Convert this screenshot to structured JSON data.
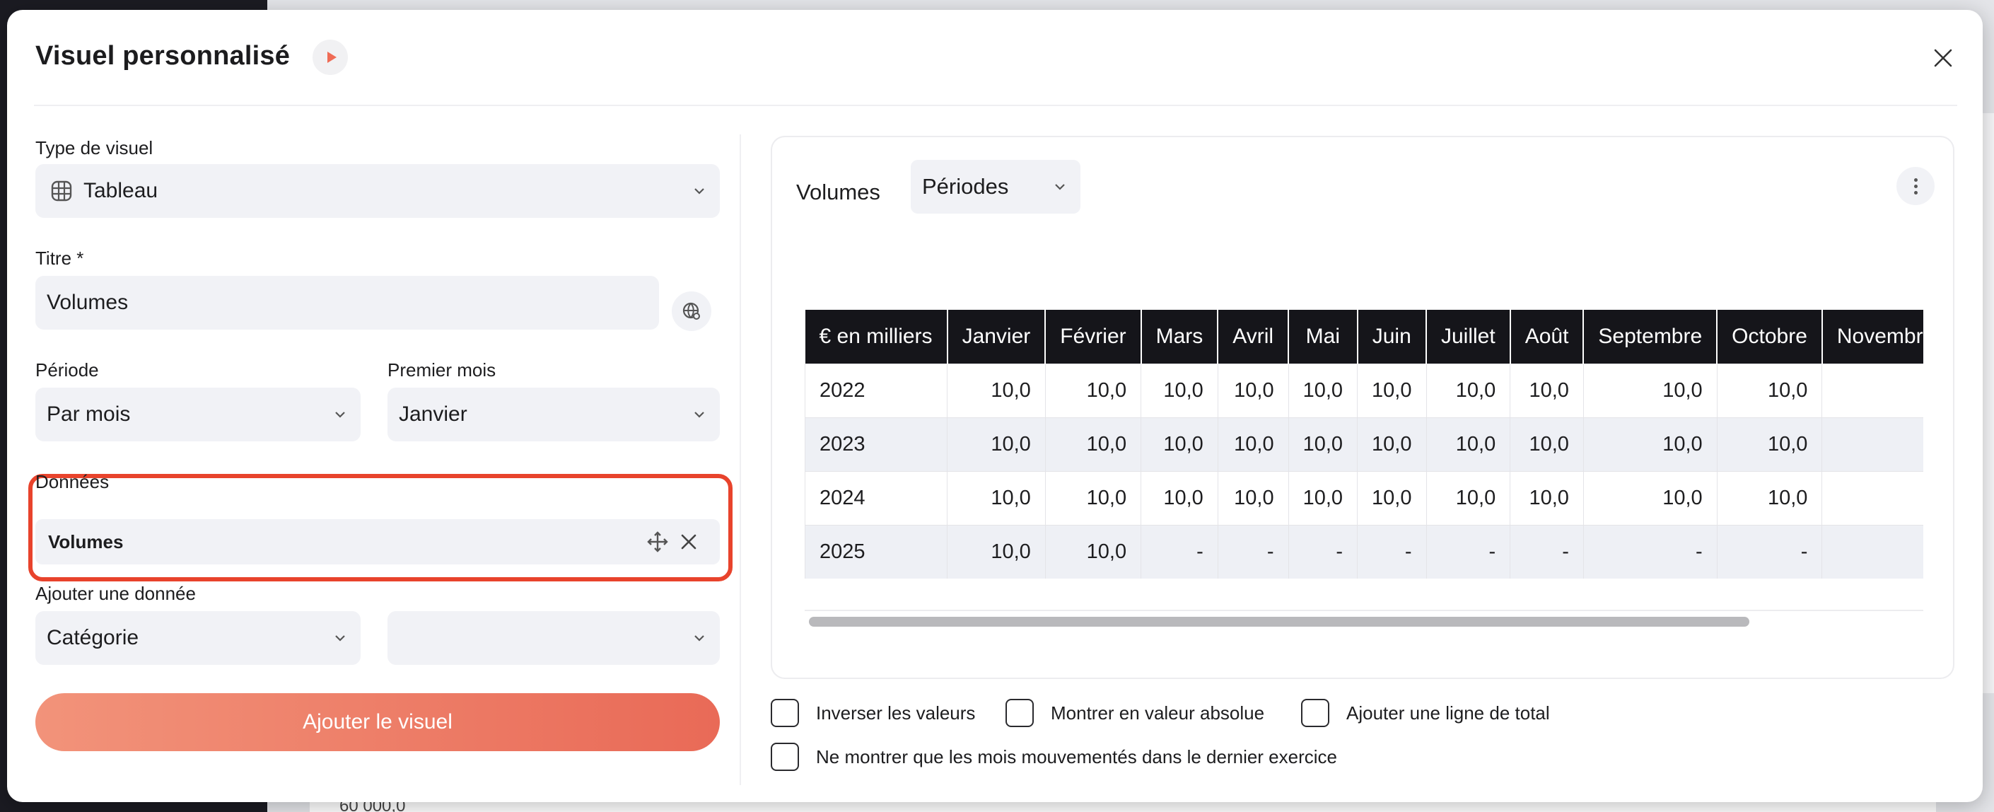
{
  "modal": {
    "title": "Visuel personnalisé"
  },
  "form": {
    "type_label": "Type de visuel",
    "type_value": "Tableau",
    "titre_label": "Titre *",
    "titre_value": "Volumes",
    "periode_label": "Période",
    "periode_value": "Par mois",
    "premier_mois_label": "Premier mois",
    "premier_mois_value": "Janvier",
    "donnees_label": "Données",
    "donnees_item": "Volumes",
    "ajouter_label": "Ajouter une donnée",
    "ajouter_category": "Catégorie",
    "ajouter_second": "",
    "submit": "Ajouter le visuel"
  },
  "preview": {
    "title": "Volumes",
    "select_value": "Périodes",
    "table": {
      "headers": [
        "€ en milliers",
        "Janvier",
        "Février",
        "Mars",
        "Avril",
        "Mai",
        "Juin",
        "Juillet",
        "Août",
        "Septembre",
        "Octobre",
        "Novembre"
      ],
      "rows": [
        [
          "2022",
          "10,0",
          "10,0",
          "10,0",
          "10,0",
          "10,0",
          "10,0",
          "10,0",
          "10,0",
          "10,0",
          "10,0",
          ""
        ],
        [
          "2023",
          "10,0",
          "10,0",
          "10,0",
          "10,0",
          "10,0",
          "10,0",
          "10,0",
          "10,0",
          "10,0",
          "10,0",
          ""
        ],
        [
          "2024",
          "10,0",
          "10,0",
          "10,0",
          "10,0",
          "10,0",
          "10,0",
          "10,0",
          "10,0",
          "10,0",
          "10,0",
          ""
        ],
        [
          "2025",
          "10,0",
          "10,0",
          "-",
          "-",
          "-",
          "-",
          "-",
          "-",
          "-",
          "-",
          ""
        ]
      ]
    }
  },
  "options": {
    "inverser": "Inverser les valeurs",
    "absolue": "Montrer en valeur absolue",
    "total": "Ajouter une ligne de total",
    "mouvementes": "Ne montrer que les mois mouvementés dans le dernier exercice"
  },
  "background": {
    "value": "60 000,0"
  },
  "icons": {
    "play": "play-icon",
    "close": "close-icon",
    "table": "table-icon",
    "globe": "globe-icon",
    "move": "move-icon",
    "remove": "remove-icon",
    "chevron": "chevron-down-icon",
    "more": "more-vertical-icon"
  },
  "colors": {
    "accent": "#e96a57",
    "highlight": "#e8432c",
    "table_header": "#15151a"
  }
}
